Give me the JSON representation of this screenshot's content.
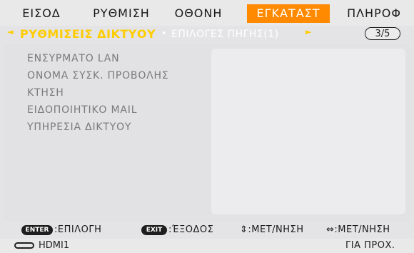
{
  "tabs": [
    {
      "label": "ΕΙΣΟΔ"
    },
    {
      "label": "ΡΥΘΜΙΣΗ"
    },
    {
      "label": "ΟΘΟΝΗ"
    },
    {
      "label": "ΕΓΚΑΤΑΣΤ"
    },
    {
      "label": "ΠΛΗΡΟΦ"
    }
  ],
  "subtabs": {
    "left_arrow": "◄",
    "active": "ΡΥΘΜΙΣΕΙΣ ΔΙΚΤΥΟΥ",
    "separator": "•",
    "other": "ΕΠΙΛΟΓΕΣ ΠΗΓΗΣ(1)",
    "right_arrow": "►",
    "page": "3/5"
  },
  "items": [
    {
      "label": "ΕΝΣΥΡΜΑΤΟ LAN"
    },
    {
      "label": "ΟΝΟΜΑ ΣΥΣΚ. ΠΡΟΒΟΛΗΣ"
    },
    {
      "label": "ΚΤΗΣΗ"
    },
    {
      "label": "ΕΙΔΟΠΟΙΗΤΙΚΟ MAIL"
    },
    {
      "label": "ΥΠΗΡΕΣΙΑ ΔΙΚΤΥΟΥ"
    }
  ],
  "footer": {
    "enter_key": "ENTER",
    "enter_text": ":ΕΠΙΛΟΓΗ",
    "exit_key": "EXIT",
    "exit_text": ":ΈΞΟΔΟΣ",
    "updown_text": "⇕:ΜΕΤ/ΝΗΣΗ",
    "leftright_text": "⇔:ΜΕΤ/ΝΗΣΗ"
  },
  "status": {
    "source": "HDMI1",
    "right": "ΓΙΑ ΠΡΟΧ."
  },
  "colors": {
    "active_tab": "#ff8a00",
    "active_subtab": "#ffcc00",
    "background": "#e4e4e6"
  }
}
